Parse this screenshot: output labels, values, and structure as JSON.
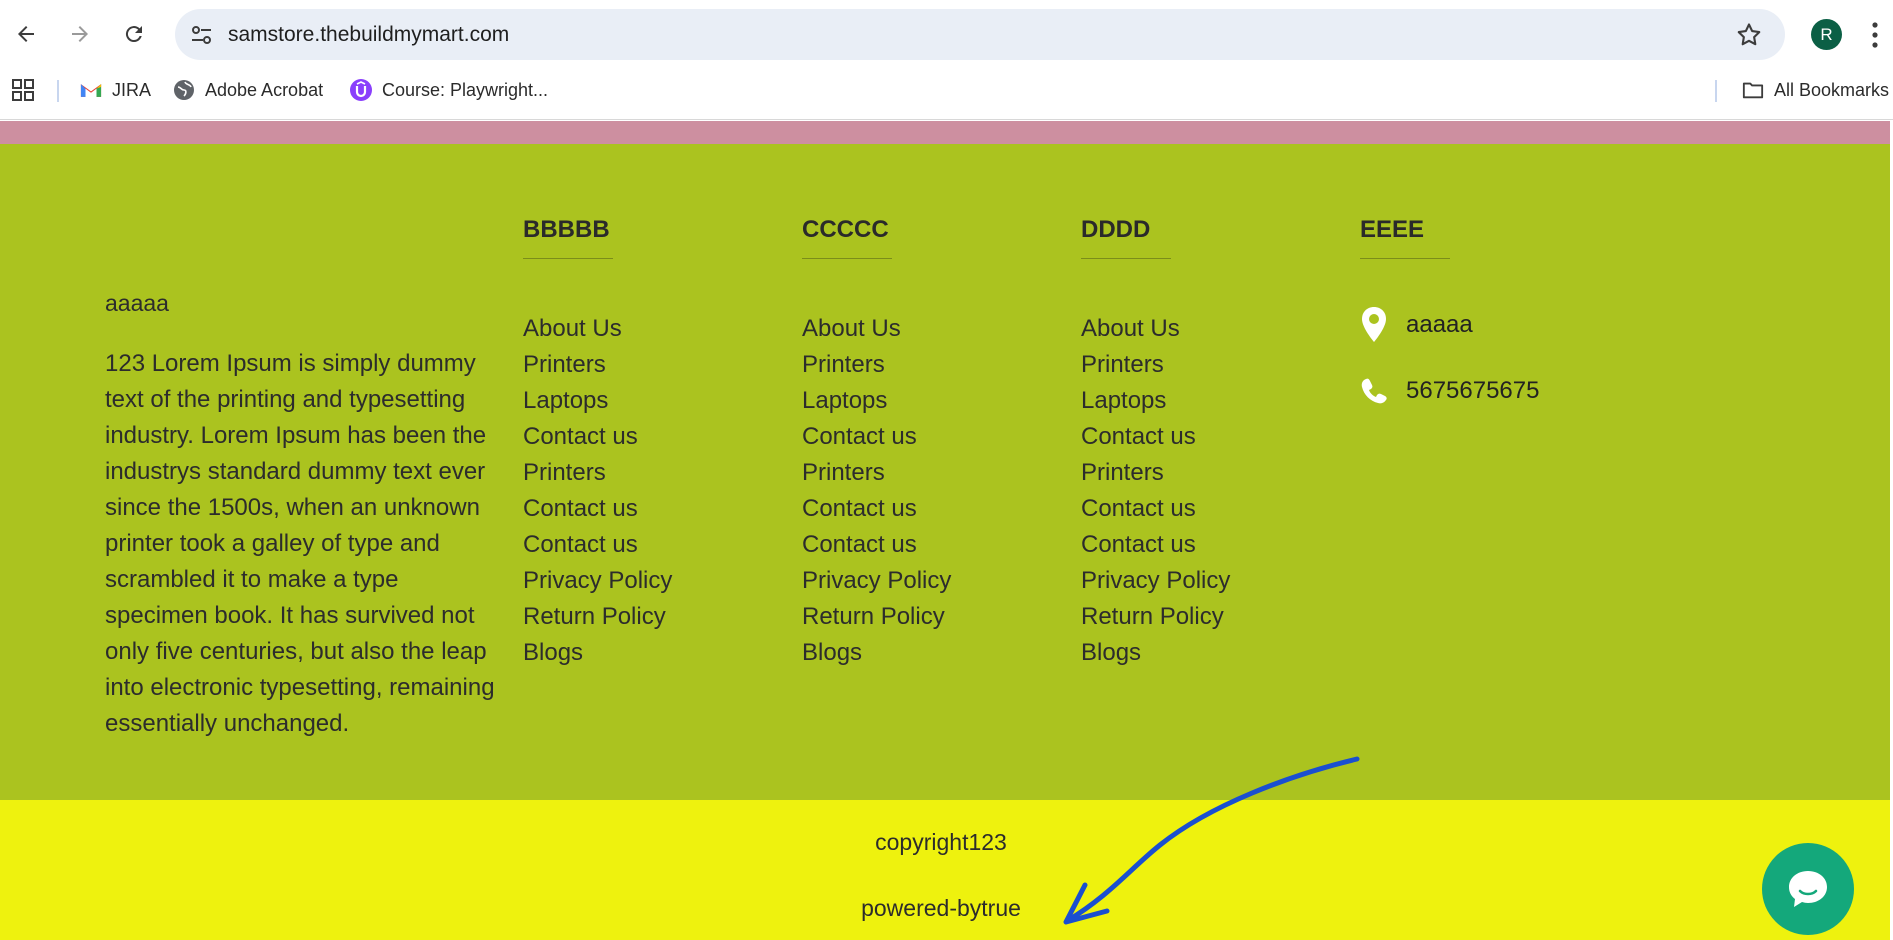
{
  "browser": {
    "url": "samstore.thebuildmymart.com",
    "profile_initial": "R",
    "bookmarks": [
      {
        "label": "JIRA",
        "icon": "gmail-icon"
      },
      {
        "label": "Adobe Acrobat",
        "icon": "globe-icon"
      },
      {
        "label": "Course: Playwright...",
        "icon": "udemy-icon"
      }
    ],
    "all_bookmarks_label": "All Bookmarks"
  },
  "footer": {
    "about_title": "aaaaa",
    "about_text": "123 Lorem Ipsum is simply dummy text of the printing and typesetting industry. Lorem Ipsum has been the industrys standard dummy text ever since the 1500s, when an unknown printer took a galley of type and scrambled it to make a type specimen book. It has survived not only five centuries, but also the leap into electronic typesetting, remaining essentially unchanged.",
    "columns": [
      {
        "title": "BBBBB",
        "links": [
          "About Us",
          "Printers",
          "Laptops",
          "Contact us",
          "Printers",
          "Contact us",
          "Contact us",
          "Privacy Policy",
          "Return Policy",
          "Blogs"
        ]
      },
      {
        "title": "CCCCC",
        "links": [
          "About Us",
          "Printers",
          "Laptops",
          "Contact us",
          "Printers",
          "Contact us",
          "Contact us",
          "Privacy Policy",
          "Return Policy",
          "Blogs"
        ]
      },
      {
        "title": "DDDD",
        "links": [
          "About Us",
          "Printers",
          "Laptops",
          "Contact us",
          "Printers",
          "Contact us",
          "Contact us",
          "Privacy Policy",
          "Return Policy",
          "Blogs"
        ]
      }
    ],
    "contact": {
      "title": "EEEE",
      "address": "aaaaa",
      "phone": "5675675675"
    },
    "copyright": "copyright123",
    "powered_by": "powered-bytrue"
  },
  "colors": {
    "footer_bg": "#abc31f",
    "bottom_bar_bg": "#eef20e",
    "top_strip": "#cd8fa0",
    "chat_button": "#14a87b",
    "annotation_arrow": "#1a4fd0"
  }
}
